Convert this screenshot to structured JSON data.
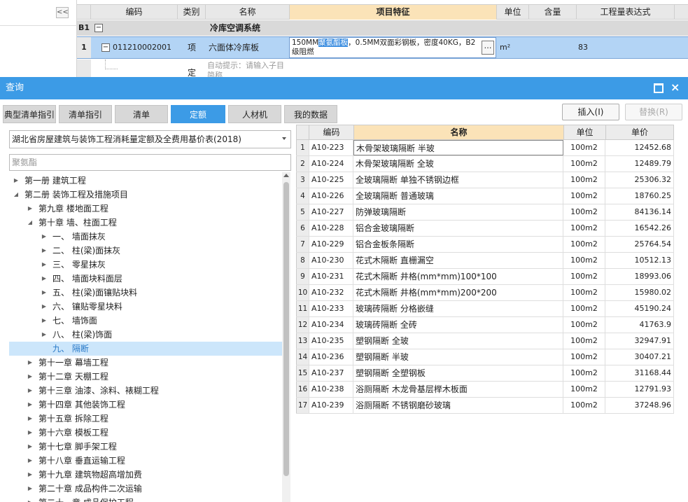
{
  "grid": {
    "collapse_label": "<<",
    "headers": [
      "编码",
      "类别",
      "名称",
      "项目特征",
      "单位",
      "含量",
      "工程量表达式"
    ],
    "b1": {
      "label": "B1",
      "toggle": "−",
      "title": "冷库空调系统"
    },
    "row1": {
      "num": "1",
      "toggle": "−",
      "code": "011210002001",
      "type": "项",
      "name": "六面体冷库板",
      "feature_a": "150MM",
      "feature_sel": "聚氨酯板",
      "feature_b": "，0.5MM双面彩钢板，密度40KG，B2级阻燃",
      "ellipsis": "…",
      "unit": "m²",
      "quantity": "83"
    },
    "row2": {
      "type": "定",
      "hint": "自动提示：请输入子目简称"
    }
  },
  "dialog": {
    "title": "查询",
    "close": "×",
    "tabs": [
      "典型清单指引",
      "清单指引",
      "清单",
      "定额",
      "人材机",
      "我的数据"
    ],
    "active_tab": "定额",
    "insert_button": "插入(I)",
    "replace_button": "替换(R)",
    "library_select": "湖北省房屋建筑与装饰工程消耗量定额及全费用基价表(2018)",
    "search_value": "聚氨酯"
  },
  "tree": [
    {
      "label": "第一册 建筑工程",
      "level": 0,
      "expanded": false
    },
    {
      "label": "第二册 装饰工程及措施项目",
      "level": 0,
      "expanded": true
    },
    {
      "label": "第九章 楼地面工程",
      "level": 1,
      "expanded": false
    },
    {
      "label": "第十章 墙、柱面工程",
      "level": 1,
      "expanded": true
    },
    {
      "label": "一、 墙面抹灰",
      "level": 2,
      "expanded": false
    },
    {
      "label": "二、 柱(梁)面抹灰",
      "level": 2,
      "expanded": false
    },
    {
      "label": "三、 零星抹灰",
      "level": 2,
      "expanded": false
    },
    {
      "label": "四、 墙面块料面层",
      "level": 2,
      "expanded": false
    },
    {
      "label": "五、 柱(梁)面镶贴块料",
      "level": 2,
      "expanded": false
    },
    {
      "label": "六、 镶贴零星块料",
      "level": 2,
      "expanded": false
    },
    {
      "label": "七、 墙饰面",
      "level": 2,
      "expanded": false
    },
    {
      "label": "八、 柱(梁)饰面",
      "level": 2,
      "expanded": false
    },
    {
      "label": "九、 隔断",
      "level": 2,
      "expanded": null,
      "selected": true
    },
    {
      "label": "第十一章 幕墙工程",
      "level": 1,
      "expanded": false
    },
    {
      "label": "第十二章 天棚工程",
      "level": 1,
      "expanded": false
    },
    {
      "label": "第十三章 油漆、涂料、裱糊工程",
      "level": 1,
      "expanded": false
    },
    {
      "label": "第十四章 其他装饰工程",
      "level": 1,
      "expanded": false
    },
    {
      "label": "第十五章 拆除工程",
      "level": 1,
      "expanded": false
    },
    {
      "label": "第十六章 模板工程",
      "level": 1,
      "expanded": false
    },
    {
      "label": "第十七章 脚手架工程",
      "level": 1,
      "expanded": false
    },
    {
      "label": "第十八章 垂直运输工程",
      "level": 1,
      "expanded": false
    },
    {
      "label": "第十九章 建筑物超高增加费",
      "level": 1,
      "expanded": false
    },
    {
      "label": "第二十章 成品构件二次运输",
      "level": 1,
      "expanded": false
    },
    {
      "label": "第二十一章 成品保护工程",
      "level": 1,
      "expanded": false
    }
  ],
  "results": {
    "headers": [
      "编码",
      "名称",
      "单位",
      "单价"
    ],
    "rows": [
      {
        "idx": "1",
        "code": "A10-223",
        "name": "木骨架玻璃隔断 半玻",
        "unit": "100m2",
        "price": "12452.68"
      },
      {
        "idx": "2",
        "code": "A10-224",
        "name": "木骨架玻璃隔断 全玻",
        "unit": "100m2",
        "price": "12489.79"
      },
      {
        "idx": "3",
        "code": "A10-225",
        "name": "全玻璃隔断 单独不锈钢边框",
        "unit": "100m2",
        "price": "25306.32"
      },
      {
        "idx": "4",
        "code": "A10-226",
        "name": "全玻璃隔断 普通玻璃",
        "unit": "100m2",
        "price": "18760.25"
      },
      {
        "idx": "5",
        "code": "A10-227",
        "name": "防弹玻璃隔断",
        "unit": "100m2",
        "price": "84136.14"
      },
      {
        "idx": "6",
        "code": "A10-228",
        "name": "铝合金玻璃隔断",
        "unit": "100m2",
        "price": "16542.26"
      },
      {
        "idx": "7",
        "code": "A10-229",
        "name": "铝合金板条隔断",
        "unit": "100m2",
        "price": "25764.54"
      },
      {
        "idx": "8",
        "code": "A10-230",
        "name": "花式木隔断 直栅漏空",
        "unit": "100m2",
        "price": "10512.13"
      },
      {
        "idx": "9",
        "code": "A10-231",
        "name": "花式木隔断 井格(mm*mm)100*100",
        "unit": "100m2",
        "price": "18993.06"
      },
      {
        "idx": "10",
        "code": "A10-232",
        "name": "花式木隔断 井格(mm*mm)200*200",
        "unit": "100m2",
        "price": "15980.02"
      },
      {
        "idx": "11",
        "code": "A10-233",
        "name": "玻璃砖隔断 分格嵌缝",
        "unit": "100m2",
        "price": "45190.24"
      },
      {
        "idx": "12",
        "code": "A10-234",
        "name": "玻璃砖隔断 全砖",
        "unit": "100m2",
        "price": "41763.9"
      },
      {
        "idx": "13",
        "code": "A10-235",
        "name": "塑钢隔断 全玻",
        "unit": "100m2",
        "price": "32947.91"
      },
      {
        "idx": "14",
        "code": "A10-236",
        "name": "塑钢隔断 半玻",
        "unit": "100m2",
        "price": "30407.21"
      },
      {
        "idx": "15",
        "code": "A10-237",
        "name": "塑钢隔断 全塑钢板",
        "unit": "100m2",
        "price": "31168.44"
      },
      {
        "idx": "16",
        "code": "A10-238",
        "name": "浴厕隔断 木龙骨基层榉木板面",
        "unit": "100m2",
        "price": "12791.93"
      },
      {
        "idx": "17",
        "code": "A10-239",
        "name": "浴厕隔断 不锈钢磨砂玻璃",
        "unit": "100m2",
        "price": "37248.96"
      }
    ]
  },
  "colors": {
    "accent": "#3c9be6",
    "header_highlight": "#fbe3b8",
    "selected_row": "#b3d4f5",
    "tree_selected": "#cce6fb"
  }
}
